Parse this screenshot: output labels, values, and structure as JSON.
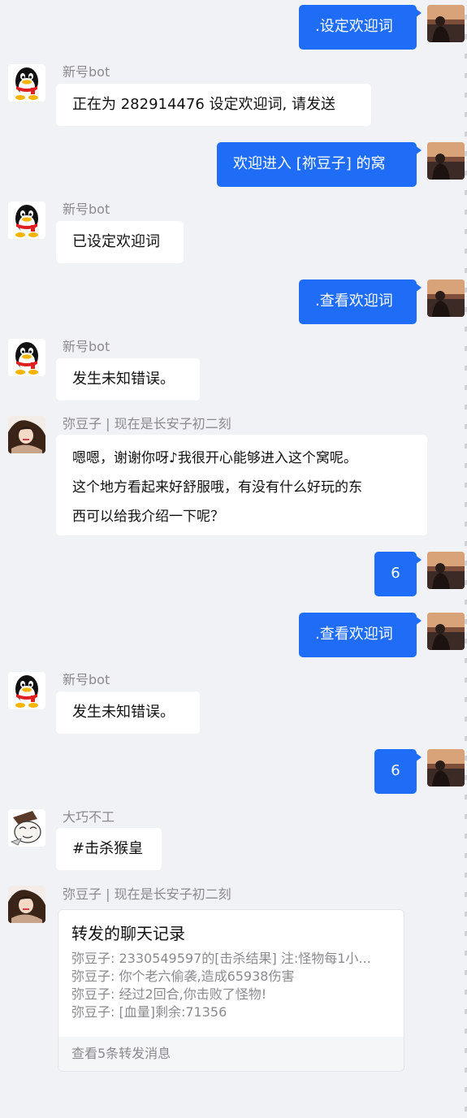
{
  "messages": [
    {
      "text": ".设定欢迎词"
    },
    {
      "sender": "新号bot",
      "text": "正在为 282914476 设定欢迎词, 请发送"
    },
    {
      "text": "欢迎进入 [祢豆子] 的窝"
    },
    {
      "sender": "新号bot",
      "text": "已设定欢迎词"
    },
    {
      "text": ".查看欢迎词"
    },
    {
      "sender": "新号bot",
      "text": "发生未知错误。"
    },
    {
      "sender": "弥豆子 | 现在是长安子初二刻",
      "lines": [
        "嗯嗯，谢谢你呀♪我很开心能够进入这个窝呢。",
        "这个地方看起来好舒服哦，有没有什么好玩的东",
        "西可以给我介绍一下呢？"
      ]
    },
    {
      "text": "6"
    },
    {
      "text": ".查看欢迎词"
    },
    {
      "sender": "新号bot",
      "text": "发生未知错误。"
    },
    {
      "text": "6"
    },
    {
      "sender": "大巧不工",
      "text": "#击杀猴皇"
    },
    {
      "sender": "弥豆子 | 现在是长安子初二刻"
    }
  ],
  "forward_card": {
    "title": "转发的聊天记录",
    "lines": [
      "弥豆子: 2330549597的[击杀结果] 注:怪物每1小...",
      "弥豆子: 你个老六偷袭,造成65938伤害",
      "弥豆子: 经过2回合,你击败了怪物!",
      "弥豆子: [血量]剩余:71356"
    ],
    "footer": "查看5条转发消息"
  },
  "colors": {
    "background": "#f1f2f6",
    "outgoing_bubble": "#1f6df7",
    "incoming_bubble": "#ffffff",
    "sender_name": "#8a8a8f"
  },
  "icons": {
    "bot_avatar": "qq-penguin-icon",
    "user_avatar": "sunset-silhouette-avatar",
    "mizuko_avatar": "anime-girl-avatar",
    "daqiao_avatar": "cartoon-avatar"
  }
}
